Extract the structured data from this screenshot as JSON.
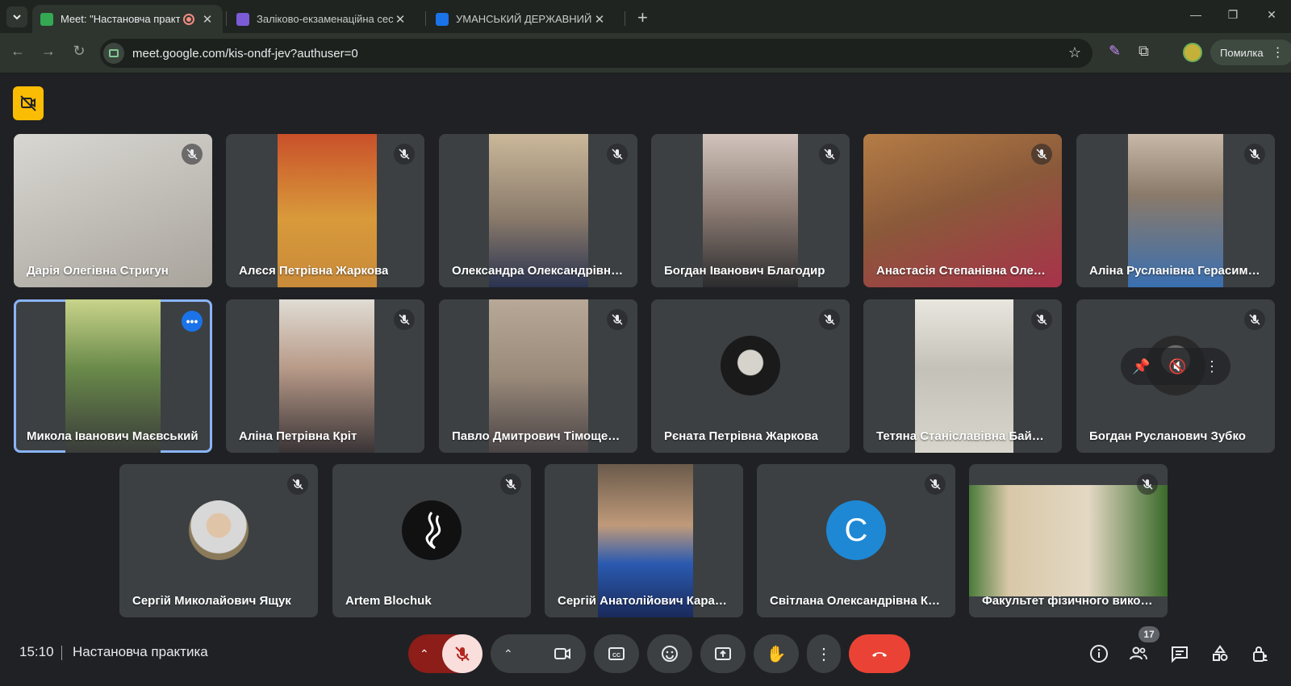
{
  "browser": {
    "tabs": [
      {
        "title": "Meet: \"Настановча практика\"",
        "active": true,
        "favicon_color": "#34a853"
      },
      {
        "title": "Заліково-екзаменаційна сесія",
        "active": false,
        "favicon_color": "#7b5cd6"
      },
      {
        "title": "УМАНСЬКИЙ ДЕРЖАВНИЙ ПЕДАГОГІЧНИЙ",
        "active": false,
        "favicon_color": "#1a73e8"
      }
    ],
    "url": "meet.google.com/kis-ondf-jev?authuser=0",
    "error_label": "Помилка"
  },
  "meet": {
    "time": "15:10",
    "meeting_title": "Настановча практика",
    "participant_count": "17",
    "participants": [
      {
        "name": "Дарія Олегівна Стригун",
        "muted": true,
        "video": "#c8c6c2"
      },
      {
        "name": "Алєся Петрівна Жаркова",
        "muted": true,
        "video": "#c98a3a"
      },
      {
        "name": "Олександра Олександрівна …",
        "muted": true,
        "video": "#8a7a6a"
      },
      {
        "name": "Богдан Іванович Благодир",
        "muted": true,
        "video": "#6c625c"
      },
      {
        "name": "Анастасія Степанівна Олексів",
        "muted": true,
        "video": "#9a6a42"
      },
      {
        "name": "Аліна Русланівна Герасимен…",
        "muted": true,
        "video": "#4a6fa8"
      },
      {
        "name": "Микола Іванович Маєвський",
        "muted": false,
        "video": "#6a8a4a"
      },
      {
        "name": "Аліна Петрівна Кріт",
        "muted": true,
        "video": "#a8988a"
      },
      {
        "name": "Павло Дмитрович Тімощенко",
        "muted": true,
        "video": "#9a8a7a"
      },
      {
        "name": "Рєната Петрівна Жаркова",
        "muted": true,
        "video": ""
      },
      {
        "name": "Тетяна Станіславівна Байрак",
        "muted": true,
        "video": "#c4c2b8"
      },
      {
        "name": "Богдан Русланович Зубко",
        "muted": true,
        "video": ""
      },
      {
        "name": "Сергій Миколайович Ящук",
        "muted": true,
        "video": ""
      },
      {
        "name": "Artem Blochuk",
        "muted": true,
        "video": ""
      },
      {
        "name": "Сергій Анатолійович Карасе…",
        "muted": false,
        "video": "#4a5a8a"
      },
      {
        "name": "Світлана Олександрівна Коз…",
        "muted": true,
        "video": "",
        "initial": "C"
      },
      {
        "name": "Факультет фізичного викова…",
        "muted": true,
        "video": "#c8b89a"
      }
    ]
  },
  "colors": {
    "accent_blue": "#8ab4f8",
    "hangup_red": "#ea4335",
    "tile_bg": "#3c4043",
    "badge_yellow": "#fbbc04"
  }
}
